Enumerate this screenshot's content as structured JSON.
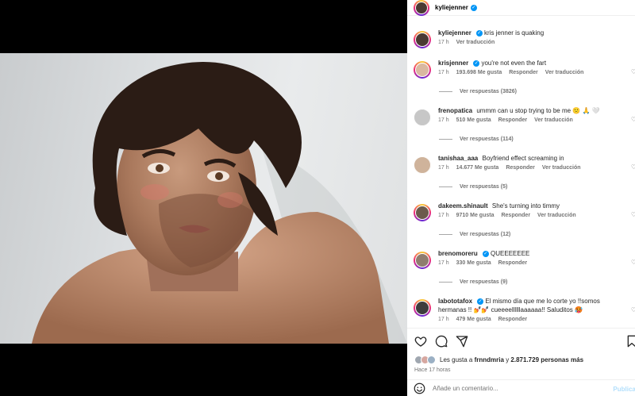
{
  "post": {
    "author": "kyliejenner",
    "likes_prefix": "Les gusta a",
    "likes_user": "frnndmria",
    "likes_join": "y",
    "likes_count": "2.871.729 personas más",
    "time": "Hace 17 horas",
    "add_comment_placeholder": "Añade un comentario...",
    "publish_label": "Publicar"
  },
  "comments": [
    {
      "user": "kyliejenner",
      "text": "kris jenner is quaking",
      "age": "17 h",
      "likes": "",
      "reply": "",
      "translate": "Ver traducción",
      "replies": ""
    },
    {
      "user": "krisjenner",
      "text": "you're not even the fart",
      "age": "17 h",
      "likes": "193.698 Me gusta",
      "reply": "Responder",
      "translate": "Ver traducción",
      "replies": "Ver respuestas (3826)"
    },
    {
      "user": "frenopatica",
      "text": "ummm can u stop trying to be me 🙁 🙏 🤍",
      "age": "17 h",
      "likes": "510 Me gusta",
      "reply": "Responder",
      "translate": "Ver traducción",
      "replies": "Ver respuestas (114)"
    },
    {
      "user": "tanishaa_aaa",
      "text": "Boyfriend effect screaming in",
      "age": "17 h",
      "likes": "14.677 Me gusta",
      "reply": "Responder",
      "translate": "Ver traducción",
      "replies": "Ver respuestas (5)"
    },
    {
      "user": "dakeem.shinault",
      "text": "She's turning into timmy",
      "age": "17 h",
      "likes": "9710 Me gusta",
      "reply": "Responder",
      "translate": "Ver traducción",
      "replies": "Ver respuestas (12)"
    },
    {
      "user": "brenomoreru",
      "text": "QUEEEEEEE",
      "age": "17 h",
      "likes": "330 Me gusta",
      "reply": "Responder",
      "translate": "",
      "replies": "Ver respuestas (9)"
    },
    {
      "user": "labototafox",
      "text": "El mismo día que me lo corte yo !!somos hermanas !! 💅💅 cueeeellllllaaaaaa!! Saluditos 🥵",
      "age": "17 h",
      "likes": "479 Me gusta",
      "reply": "Responder",
      "translate": "",
      "replies": ""
    }
  ],
  "icons": {
    "verified": "verified-badge-icon",
    "heart": "heart-icon",
    "comment": "comment-icon",
    "share": "send-icon",
    "save": "bookmark-icon",
    "emoji": "emoji-icon"
  },
  "colors": {
    "accent": "#0095f6",
    "muted": "#737373",
    "publish": "#b2dffc"
  }
}
